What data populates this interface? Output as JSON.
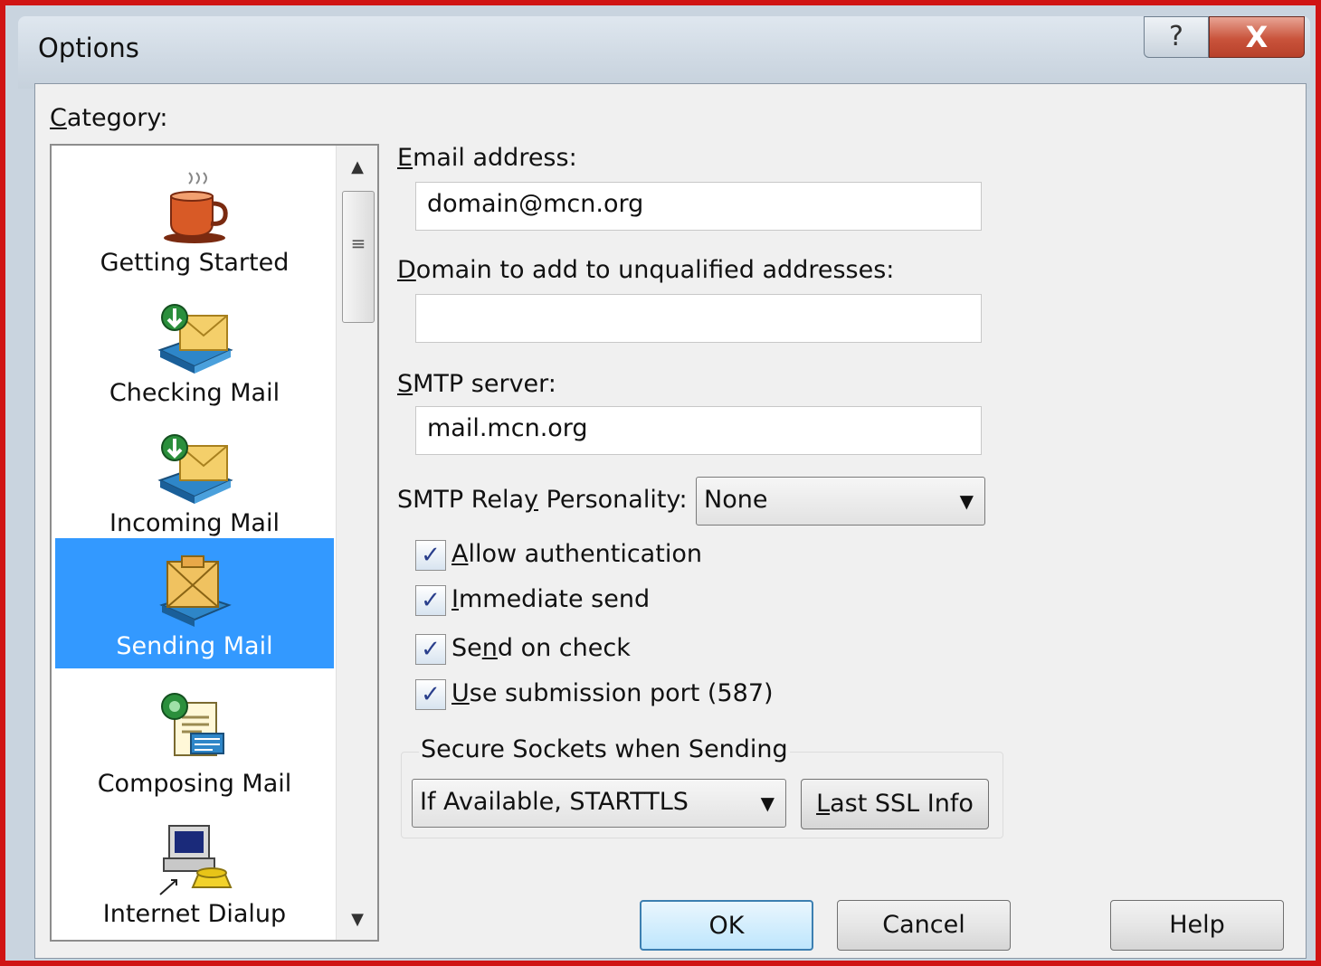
{
  "window": {
    "title": "Options",
    "help_glyph": "?",
    "close_glyph": "X"
  },
  "category": {
    "label": "Category:",
    "items": [
      {
        "label": "Getting Started",
        "icon": "coffee-cup-icon"
      },
      {
        "label": "Checking Mail",
        "icon": "checking-mail-icon"
      },
      {
        "label": "Incoming Mail",
        "icon": "incoming-mail-icon"
      },
      {
        "label": "Sending Mail",
        "icon": "sending-mail-icon",
        "selected": true
      },
      {
        "label": "Composing Mail",
        "icon": "composing-mail-icon"
      },
      {
        "label": "Internet Dialup",
        "icon": "dialup-computer-icon"
      }
    ],
    "scroll_up": "▲",
    "scroll_down": "▼",
    "scroll_grip": "≡"
  },
  "form": {
    "email_label": "Email address:",
    "email_value": "domain@mcn.org",
    "domain_label": "Domain to add to unqualified addresses:",
    "domain_value": "",
    "smtp_label": "SMTP server:",
    "smtp_value": "mail.mcn.org",
    "relay_label": "SMTP Relay Personality:",
    "relay_value": "None",
    "checkboxes": [
      {
        "label": "Allow authentication",
        "checked": true
      },
      {
        "label": "Immediate send",
        "checked": true
      },
      {
        "label": "Send on check",
        "checked": true
      },
      {
        "label": "Use submission port (587)",
        "checked": true
      }
    ],
    "check_glyph": "✓",
    "ssl_group_label": "Secure Sockets when Sending",
    "ssl_value": "If Available, STARTTLS",
    "ssl_info_button": "Last SSL Info",
    "dropdown_arrow": "▼"
  },
  "buttons": {
    "ok": "OK",
    "cancel": "Cancel",
    "help": "Help"
  },
  "colors": {
    "selection": "#3399ff",
    "frame_border": "#d01414",
    "ok_border": "#3c7fb1"
  }
}
